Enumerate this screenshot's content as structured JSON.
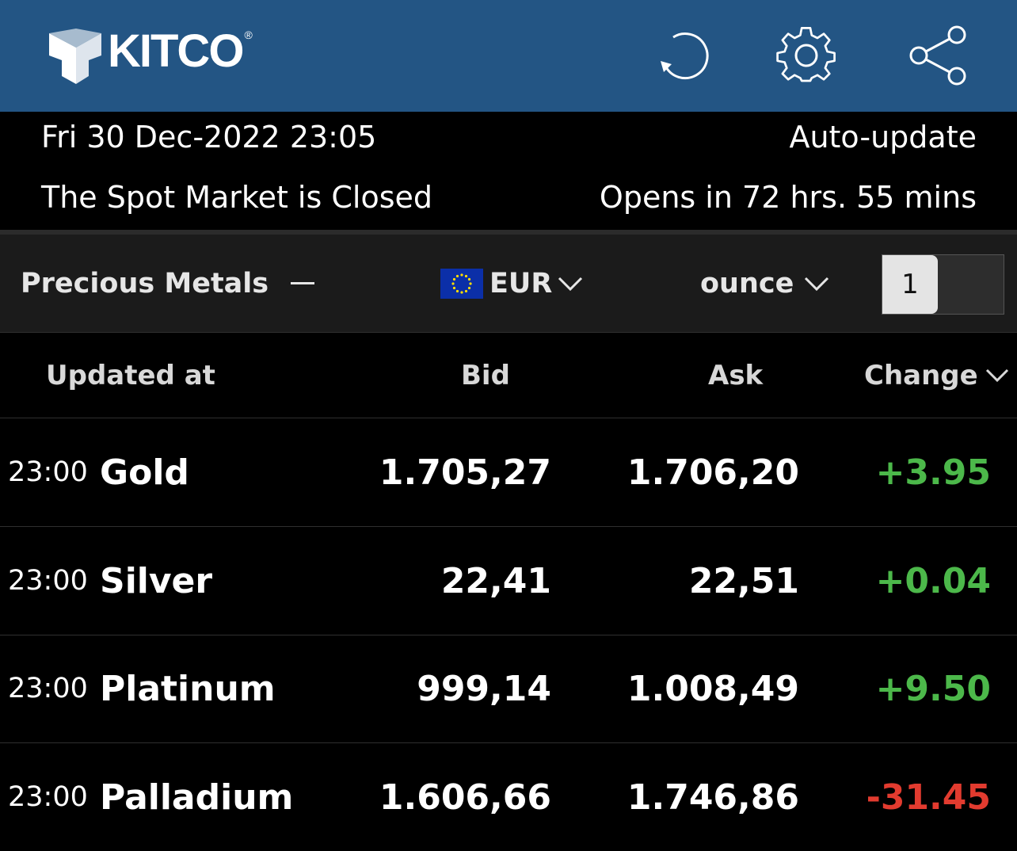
{
  "header": {
    "brand": "KITCO",
    "registered": "®",
    "icons": [
      "refresh-icon",
      "gear-icon",
      "share-icon"
    ],
    "background": "#235584"
  },
  "info": {
    "datetime": "Fri 30 Dec-2022 23:05",
    "auto_update": "Auto-update",
    "market_status": "The Spot Market is Closed",
    "opens_in": "Opens in 72 hrs. 55 mins"
  },
  "selector": {
    "category": "Precious Metals",
    "category_icon": "minus-icon",
    "currency": "EUR",
    "currency_icon": "eu-flag-icon",
    "unit": "ounce",
    "quantity": "1"
  },
  "columns": {
    "updated_at": "Updated at",
    "bid": "Bid",
    "ask": "Ask",
    "change": "Change"
  },
  "rows": [
    {
      "time": "23:00",
      "metal": "Gold",
      "bid": "1.705,27",
      "ask": "1.706,20",
      "change": "+3.95",
      "direction": "up"
    },
    {
      "time": "23:00",
      "metal": "Silver",
      "bid": "22,41",
      "ask": "22,51",
      "change": "+0.04",
      "direction": "up"
    },
    {
      "time": "23:00",
      "metal": "Platinum",
      "bid": "999,14",
      "ask": "1.008,49",
      "change": "+9.50",
      "direction": "up"
    },
    {
      "time": "23:00",
      "metal": "Palladium",
      "bid": "1.606,66",
      "ask": "1.746,86",
      "change": "-31.45",
      "direction": "down"
    }
  ],
  "colors": {
    "positive": "#4cb84a",
    "negative": "#e23b2f"
  }
}
